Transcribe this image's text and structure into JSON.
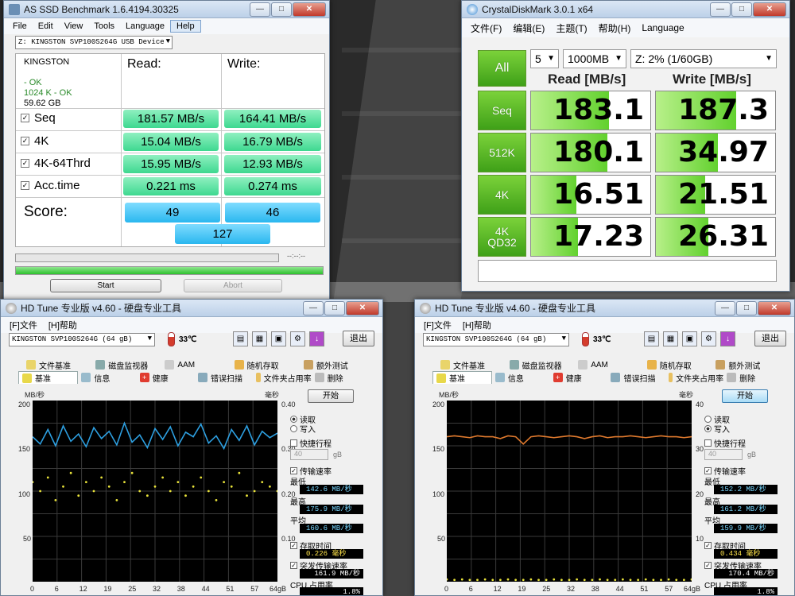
{
  "as_ssd": {
    "title": "AS SSD Benchmark 1.6.4194.30325",
    "menu": [
      "File",
      "Edit",
      "View",
      "Tools",
      "Language",
      "Help"
    ],
    "drive_select": "Z: KINGSTON  SVP100S264G USB Device",
    "drive": {
      "name": "KINGSTON",
      "status1": "- OK",
      "status2": "1024 K - OK",
      "size": "59.62 GB"
    },
    "read_label": "Read:",
    "write_label": "Write:",
    "rows": [
      {
        "label": "Seq",
        "read": "181.57 MB/s",
        "write": "164.41 MB/s"
      },
      {
        "label": "4K",
        "read": "15.04 MB/s",
        "write": "16.79 MB/s"
      },
      {
        "label": "4K-64Thrd",
        "read": "15.95 MB/s",
        "write": "12.93 MB/s"
      },
      {
        "label": "Acc.time",
        "read": "0.221 ms",
        "write": "0.274 ms"
      }
    ],
    "score_label": "Score:",
    "score_read": "49",
    "score_write": "46",
    "score_total": "127",
    "progress_time": "--:--:--",
    "progress_top": 0,
    "progress_bottom": 1,
    "start_label": "Start",
    "abort_label": "Abort"
  },
  "cdm": {
    "title": "CrystalDiskMark 3.0.1 x64",
    "menu": [
      "文件(F)",
      "编辑(E)",
      "主题(T)",
      "帮助(H)",
      "Language"
    ],
    "all_label": "All",
    "count": "5",
    "size": "1000MB",
    "drive": "Z: 2% (1/60GB)",
    "read_head": "Read [MB/s]",
    "write_head": "Write [MB/s]",
    "rows": [
      {
        "label": "Seq",
        "read": "183.1",
        "write": "187.3",
        "read_fill": 0.65,
        "write_fill": 0.67
      },
      {
        "label": "512K",
        "read": "180.1",
        "write": "34.97",
        "read_fill": 0.64,
        "write_fill": 0.52
      },
      {
        "label": "4K",
        "read": "16.51",
        "write": "21.51",
        "read_fill": 0.38,
        "write_fill": 0.41
      },
      {
        "label": "4K\nQD32",
        "read": "17.23",
        "write": "26.31",
        "read_fill": 0.39,
        "write_fill": 0.44
      }
    ]
  },
  "hdtune_read": {
    "title": "HD Tune 专业版 v4.60 - 硬盘专业工具",
    "menu": [
      "[F]文件",
      "[H]帮助"
    ],
    "drive": "KINGSTON SVP100S264G   (64 gB)",
    "temp": "33℃",
    "exit_label": "退出",
    "tabs_top": [
      "文件基准",
      "磁盘监视器",
      "AAM",
      "随机存取",
      "额外测试"
    ],
    "tabs_bottom": [
      "基准",
      "信息",
      "健康",
      "错误扫描",
      "文件夹占用率",
      "删除"
    ],
    "unit_left": "MB/秒",
    "unit_right": "毫秒",
    "y_left": [
      "200",
      "150",
      "100",
      "50"
    ],
    "y_right": [
      "0.40",
      "0.30",
      "0.20",
      "0.10"
    ],
    "x_ticks": [
      "0",
      "6",
      "12",
      "19",
      "25",
      "32",
      "38",
      "44",
      "51",
      "57",
      "64gB"
    ],
    "start_label": "开始",
    "read_label": "读取",
    "write_label": "写入",
    "mode": "read",
    "short_stroke": "快捷行程",
    "short_stroke_value": "40",
    "short_stroke_unit": "gB",
    "transfer_rate": "传输速率",
    "min_label": "最低",
    "min": "142.6 MB/秒",
    "max_label": "最高",
    "max": "175.9 MB/秒",
    "avg_label": "平均",
    "avg": "160.6 MB/秒",
    "access_label": "存取时间",
    "access": "0.226 毫秒",
    "burst_label": "突发传输速率",
    "burst": "161.9 MB/秒",
    "cpu_label": "CPU 占用率",
    "cpu": "1.8%"
  },
  "hdtune_write": {
    "title": "HD Tune 专业版 v4.60 - 硬盘专业工具",
    "menu": [
      "[F]文件",
      "[H]帮助"
    ],
    "drive": "KINGSTON SVP100S264G   (64 gB)",
    "temp": "33℃",
    "exit_label": "退出",
    "tabs_top": [
      "文件基准",
      "磁盘监视器",
      "AAM",
      "随机存取",
      "额外测试"
    ],
    "tabs_bottom": [
      "基准",
      "信息",
      "健康",
      "错误扫描",
      "文件夹占用率",
      "删除"
    ],
    "unit_left": "MB/秒",
    "unit_right": "毫秒",
    "y_left": [
      "200",
      "150",
      "100",
      "50"
    ],
    "y_right": [
      "40",
      "30",
      "20",
      "10"
    ],
    "x_ticks": [
      "0",
      "6",
      "12",
      "19",
      "25",
      "32",
      "38",
      "44",
      "51",
      "57",
      "64gB"
    ],
    "start_label": "开始",
    "read_label": "读取",
    "write_label": "写入",
    "mode": "write",
    "short_stroke": "快捷行程",
    "short_stroke_value": "40",
    "short_stroke_unit": "gB",
    "transfer_rate": "传输速率",
    "min_label": "最低",
    "min": "152.2 MB/秒",
    "max_label": "最高",
    "max": "161.2 MB/秒",
    "avg_label": "平均",
    "avg": "159.9 MB/秒",
    "access_label": "存取时间",
    "access": "0.434 毫秒",
    "burst_label": "突发传输速率",
    "burst": "170.4 MB/秒",
    "cpu_label": "CPU 占用率",
    "cpu": "1.8%"
  },
  "chart_data": [
    {
      "type": "line",
      "x": [
        0,
        2,
        4,
        6,
        8,
        10,
        12,
        14,
        16,
        18,
        20,
        22,
        24,
        26,
        28,
        30,
        32,
        34,
        36,
        38,
        40,
        42,
        44,
        46,
        48,
        50,
        52,
        54,
        56,
        58,
        60,
        62,
        64
      ],
      "xlim": [
        0,
        64
      ],
      "ylim": [
        0,
        200
      ],
      "y2lim": [
        0,
        0.4
      ],
      "xlabel": "",
      "ylabel": "MB/秒",
      "y2label": "毫秒",
      "series": [
        {
          "values": [
            160,
            152,
            168,
            150,
            172,
            155,
            163,
            149,
            170,
            158,
            166,
            151,
            175,
            154,
            162,
            148,
            169,
            157,
            171,
            150,
            165,
            160,
            174,
            153,
            161,
            147,
            168,
            156,
            172,
            151,
            166,
            159,
            164
          ],
          "color": "#2d9fe0"
        },
        {
          "values": [
            0.22,
            0.2,
            0.23,
            0.18,
            0.21,
            0.24,
            0.19,
            0.22,
            0.2,
            0.23,
            0.21,
            0.18,
            0.22,
            0.24,
            0.2,
            0.19,
            0.21,
            0.23,
            0.2,
            0.22,
            0.19,
            0.21,
            0.23,
            0.2,
            0.18,
            0.22,
            0.21,
            0.24,
            0.19,
            0.2,
            0.22,
            0.21,
            0.2
          ],
          "color": "#e8e23a"
        }
      ]
    },
    {
      "type": "line",
      "x": [
        0,
        2,
        4,
        6,
        8,
        10,
        12,
        14,
        16,
        18,
        20,
        22,
        24,
        26,
        28,
        30,
        32,
        34,
        36,
        38,
        40,
        42,
        44,
        46,
        48,
        50,
        52,
        54,
        56,
        58,
        60,
        62,
        64
      ],
      "xlim": [
        0,
        64
      ],
      "ylim": [
        0,
        200
      ],
      "y2lim": [
        0,
        40
      ],
      "xlabel": "",
      "ylabel": "MB/秒",
      "y2label": "毫秒",
      "series": [
        {
          "values": [
            160,
            161,
            160,
            159,
            161,
            160,
            160,
            158,
            161,
            160,
            152,
            160,
            161,
            160,
            159,
            160,
            161,
            160,
            158,
            160,
            161,
            159,
            160,
            160,
            161,
            160,
            159,
            160,
            161,
            160,
            160,
            159,
            160
          ],
          "color": "#e07a2e"
        },
        {
          "values": [
            0.5,
            0.4,
            0.5,
            0.4,
            0.4,
            0.5,
            0.4,
            0.4,
            0.5,
            0.4,
            0.4,
            0.5,
            0.4,
            0.4,
            0.5,
            0.4,
            0.4,
            0.5,
            0.4,
            0.4,
            0.5,
            0.4,
            0.4,
            0.5,
            0.4,
            0.4,
            0.5,
            0.4,
            0.4,
            0.5,
            0.4,
            0.4,
            0.5
          ],
          "color": "#e8e23a"
        }
      ]
    }
  ]
}
